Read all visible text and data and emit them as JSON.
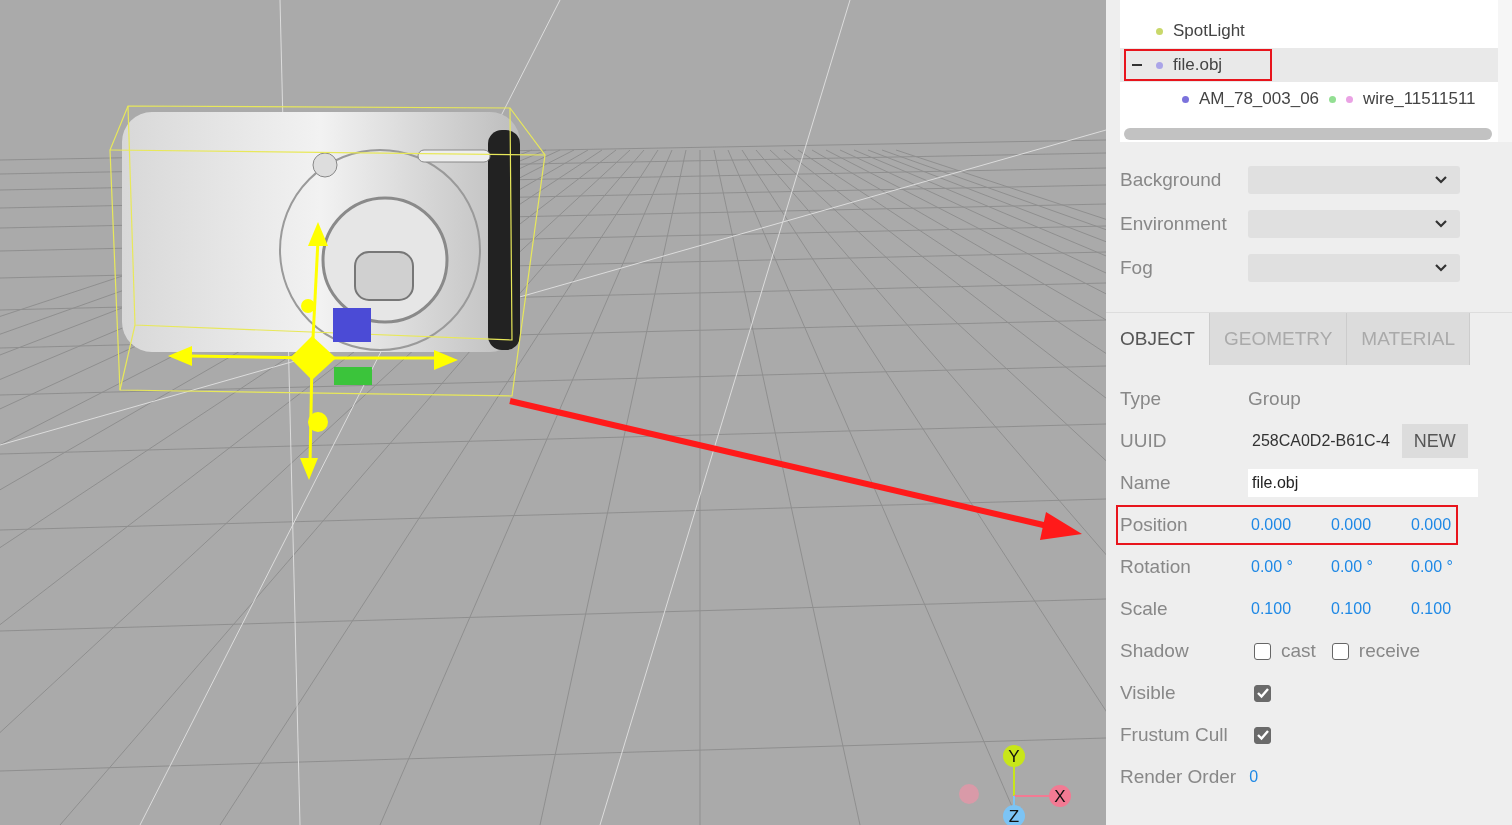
{
  "viewport": {
    "axes_helper": [
      {
        "label": "Y",
        "color": "#c8e619"
      },
      {
        "label": "X",
        "color": "#f27a93"
      },
      {
        "label": "Z",
        "color": "#7cc4f5"
      }
    ]
  },
  "outliner": {
    "items": [
      {
        "label": "SpotLight",
        "color": "#c9d86a",
        "selected": false,
        "annotated": false
      },
      {
        "label": "file.obj",
        "color": "#aaa4e8",
        "selected": true,
        "expanded": true,
        "annotated": true,
        "children": [
          {
            "label": "AM_78_003_06",
            "color": "#7b72dc",
            "tags": [
              {
                "color": "#93df93"
              },
              {
                "color": "#eaa2e4",
                "label": "wire_11511511"
              }
            ]
          }
        ]
      }
    ]
  },
  "scene_settings": [
    {
      "label": "Background"
    },
    {
      "label": "Environment"
    },
    {
      "label": "Fog"
    }
  ],
  "tabs": [
    {
      "label": "OBJECT",
      "selected": true
    },
    {
      "label": "GEOMETRY",
      "selected": false
    },
    {
      "label": "MATERIAL",
      "selected": false
    }
  ],
  "properties": [
    {
      "kind": "text",
      "label": "Type",
      "value": "Group"
    },
    {
      "kind": "uuid",
      "label": "UUID",
      "value": "258CA0D2-B61C-4",
      "button": "NEW"
    },
    {
      "kind": "input",
      "label": "Name",
      "value": "file.obj"
    },
    {
      "kind": "vector",
      "label": "Position",
      "values": [
        "0.000",
        "0.000",
        "0.000"
      ],
      "annotated": true
    },
    {
      "kind": "vector",
      "label": "Rotation",
      "values": [
        "0.00 °",
        "0.00 °",
        "0.00 °"
      ],
      "annotated": false
    },
    {
      "kind": "vector",
      "label": "Scale",
      "values": [
        "0.100",
        "0.100",
        "0.100"
      ],
      "annotated": false
    },
    {
      "kind": "checks",
      "label": "Shadow",
      "options": [
        {
          "label": "cast",
          "checked": false
        },
        {
          "label": "receive",
          "checked": false
        }
      ]
    },
    {
      "kind": "check",
      "label": "Visible",
      "checked": true
    },
    {
      "kind": "check",
      "label": "Frustum Cull",
      "checked": true
    },
    {
      "kind": "number",
      "label": "Render Order",
      "value": "0"
    }
  ]
}
